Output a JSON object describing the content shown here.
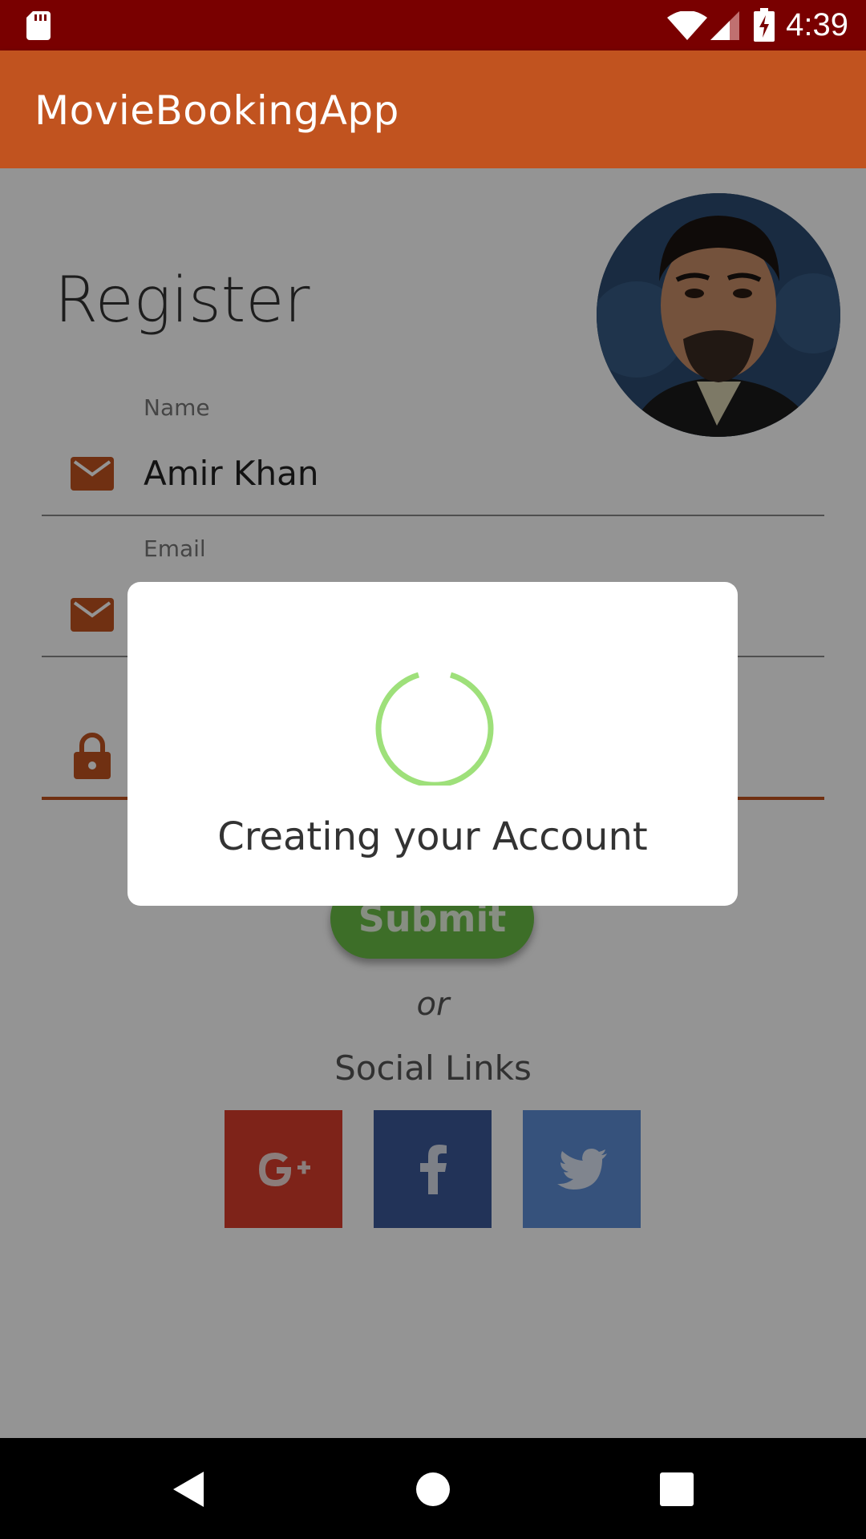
{
  "status_bar": {
    "time": "4:39"
  },
  "app_bar": {
    "title": "MovieBookingApp"
  },
  "form": {
    "heading": "Register",
    "name_label": "Name",
    "name_value": "Amir Khan",
    "email_label": "Email",
    "submit_label": "Submit",
    "or_text": "or",
    "social_title": "Social Links"
  },
  "social": [
    {
      "icon": "google-plus-icon",
      "color": "#d93d2b"
    },
    {
      "icon": "facebook-icon",
      "color": "#3b5998"
    },
    {
      "icon": "twitter-icon",
      "color": "#5e8ed6"
    }
  ],
  "dialog": {
    "message": "Creating your Account",
    "spinner_color": "#9ee07a"
  },
  "colors": {
    "status_bar": "#790000",
    "app_bar": "#c1531f",
    "accent": "#c1531f",
    "submit": "#6abd45"
  }
}
